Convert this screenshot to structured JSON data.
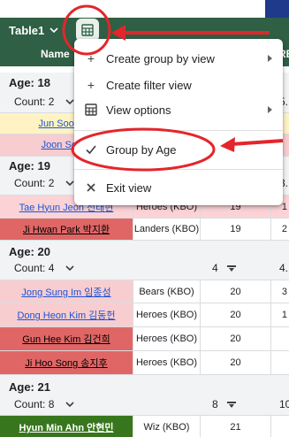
{
  "header": {
    "table_label": "Table1",
    "col_name": "Name",
    "col_right_partial": "RB"
  },
  "menu": {
    "items": [
      {
        "label": "Create group by view",
        "icon": "plus-icon",
        "submenu": true
      },
      {
        "label": "Create filter view",
        "icon": "plus-icon",
        "submenu": false
      },
      {
        "label": "View options",
        "icon": "table-view-icon",
        "submenu": true
      },
      {
        "label": "Group by Age",
        "icon": "checkmark-icon",
        "submenu": false,
        "checked": true
      },
      {
        "label": "Exit view",
        "icon": "close-icon",
        "submenu": false
      }
    ]
  },
  "groups": [
    {
      "title": "Age: 18",
      "count": "Count: 2",
      "right": "5."
    },
    {
      "title": "Age: 19",
      "count": "Count: 2",
      "right": "3."
    },
    {
      "title": "Age: 20",
      "count": "Count: 4",
      "num": "4",
      "right": "4."
    },
    {
      "title": "Age: 21",
      "count": "Count: 8",
      "num": "8",
      "right": "10"
    }
  ],
  "rows": [
    {
      "name": "Jun Soon Pa",
      "team": "",
      "age": "",
      "extra": "",
      "style": "yellow"
    },
    {
      "name": "Joon Seo E",
      "team": "",
      "age": "",
      "extra": "",
      "style": "pink"
    },
    {
      "name": "Tae Hyun Jeon 전태현",
      "team": "Heroes (KBO)",
      "age": "19",
      "extra": "1",
      "style": "pink"
    },
    {
      "name": "Ji Hwan Park 박지환",
      "team": "Landers (KBO)",
      "age": "19",
      "extra": "2",
      "style": "red"
    },
    {
      "name": "Jong Sung Im 임종성",
      "team": "Bears (KBO)",
      "age": "20",
      "extra": "3",
      "style": "pink"
    },
    {
      "name": "Dong Heon Kim 김동헌",
      "team": "Heroes (KBO)",
      "age": "20",
      "extra": "1",
      "style": "pink"
    },
    {
      "name": "Gun Hee Kim 김건희",
      "team": "Heroes (KBO)",
      "age": "20",
      "extra": "",
      "style": "red"
    },
    {
      "name": "Ji Hoo Song 송지후",
      "team": "Heroes (KBO)",
      "age": "20",
      "extra": "",
      "style": "red"
    },
    {
      "name": "Hyun Min Ahn 안현민",
      "team": "Wiz (KBO)",
      "age": "21",
      "extra": "",
      "style": "green"
    }
  ],
  "colors": {
    "header_green": "#2f5f44",
    "annotation_red": "#e3262b",
    "link_blue": "#1a55d6"
  }
}
